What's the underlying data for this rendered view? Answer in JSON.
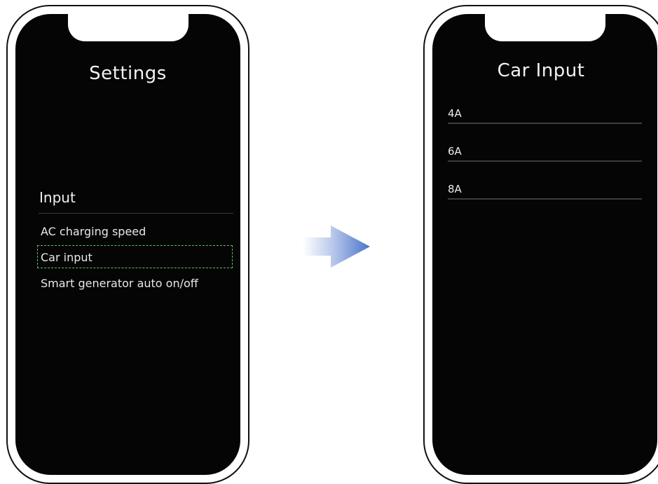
{
  "left_screen": {
    "title": "Settings",
    "section": "Input",
    "items": [
      {
        "label": "AC charging speed"
      },
      {
        "label": "Car input",
        "highlighted": true
      },
      {
        "label": "Smart generator auto on/off"
      }
    ],
    "highlight_color": "#5ec45e"
  },
  "right_screen": {
    "title": "Car Input",
    "options": [
      {
        "label": "4A"
      },
      {
        "label": "6A"
      },
      {
        "label": "8A"
      }
    ]
  },
  "arrow": {
    "icon": "right-arrow-icon",
    "color": "#4a73c9"
  }
}
